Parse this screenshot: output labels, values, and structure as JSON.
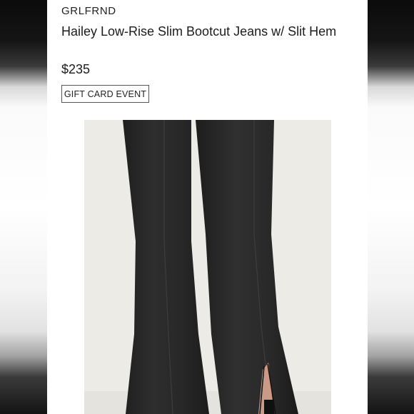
{
  "product": {
    "brand": "GRLFRND",
    "title": "Hailey Low-Rise Slim Bootcut Jeans w/ Slit Hem",
    "price": "$235",
    "badge": "GIFT CARD EVENT"
  },
  "image": {
    "subject": "black-jeans-slit-hem",
    "background_color": "#ecebe6",
    "denim_color": "#262626"
  }
}
